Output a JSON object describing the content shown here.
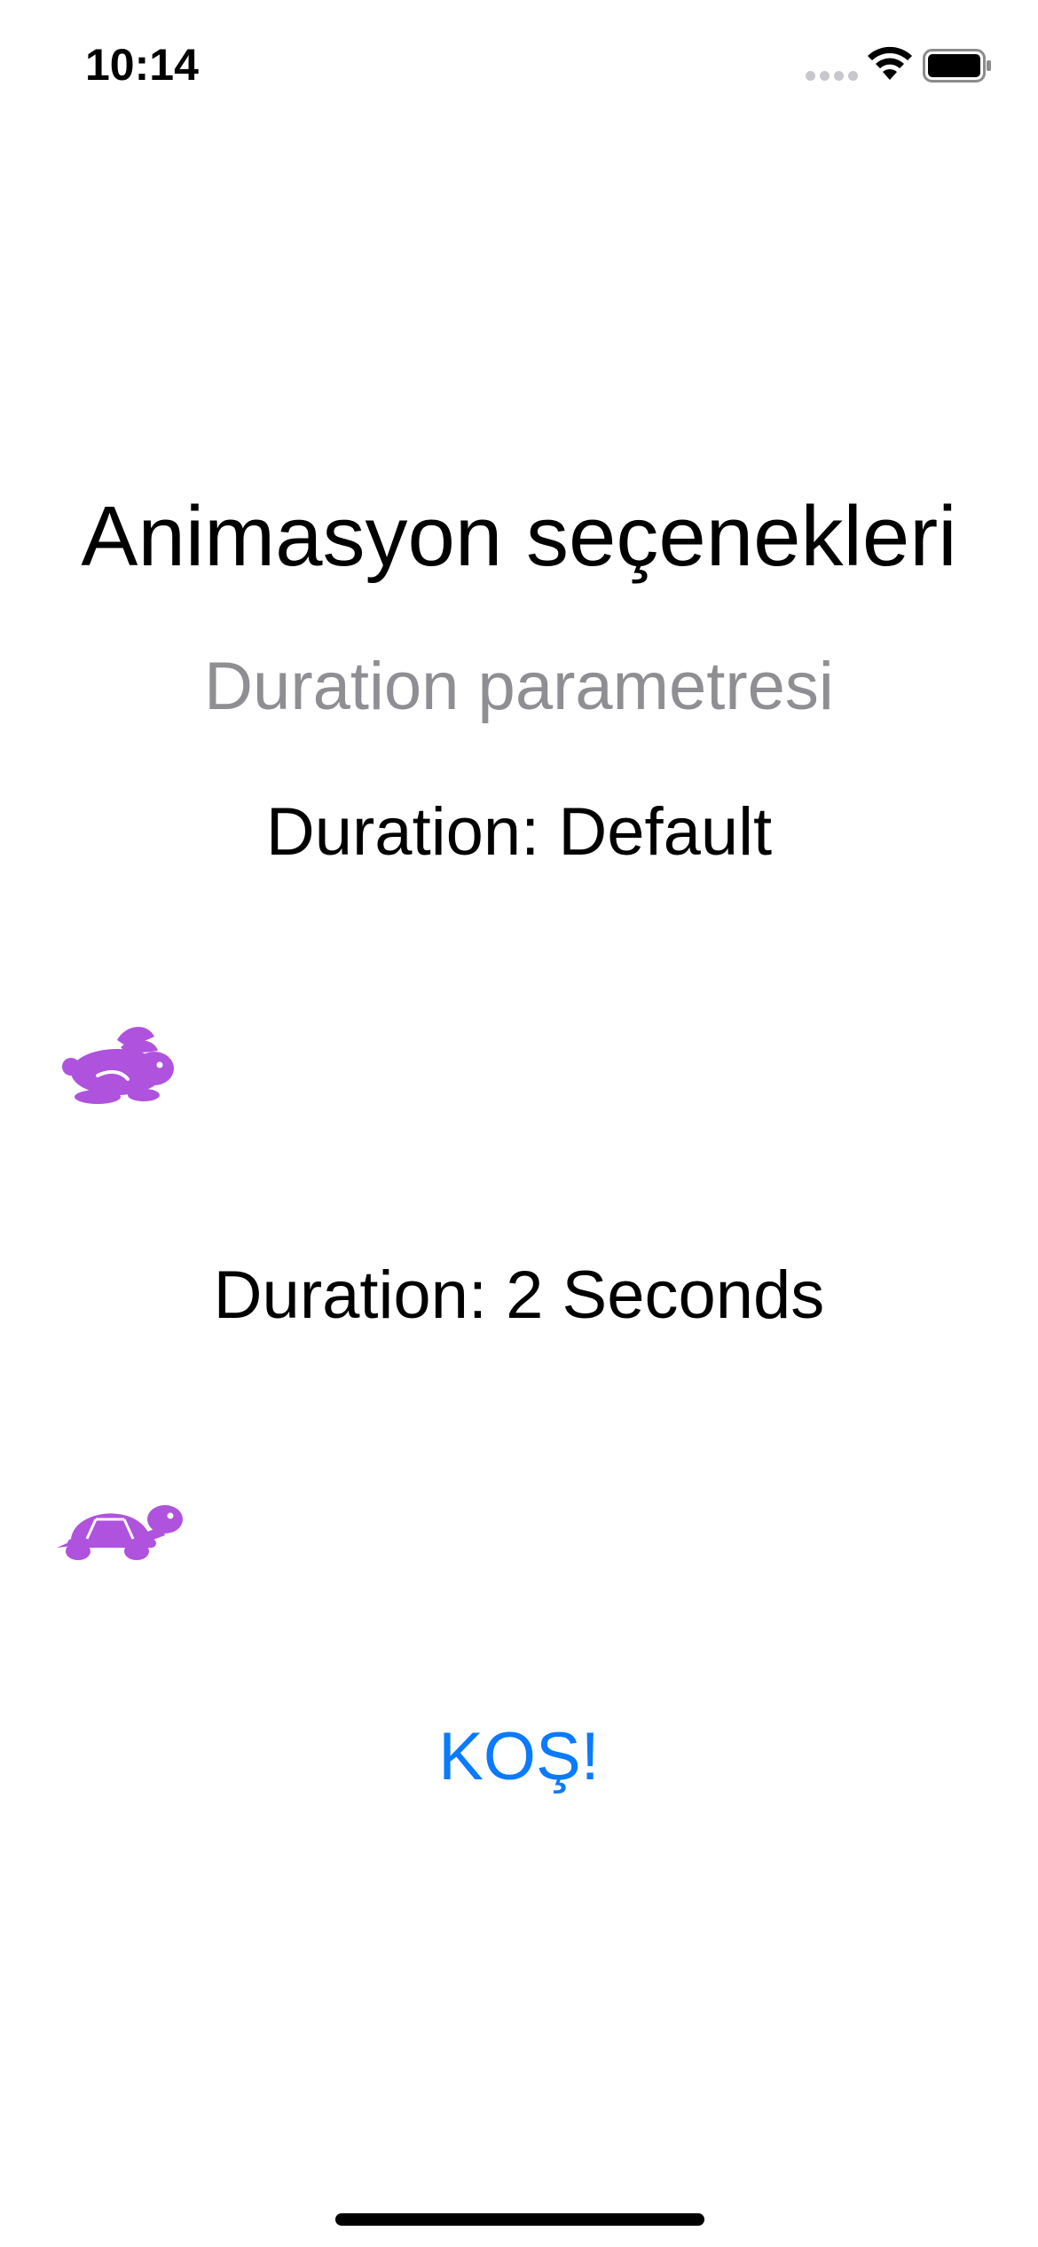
{
  "status_bar": {
    "time": "10:14",
    "signal_icon": "cellular-dots-icon",
    "wifi_icon": "wifi-icon",
    "battery_icon": "battery-icon"
  },
  "main": {
    "title": "Animasyon seçenekleri",
    "subtitle": "Duration parametresi",
    "rows": [
      {
        "label": "Duration: Default",
        "icon": "rabbit-icon",
        "icon_color": "#af52de"
      },
      {
        "label": "Duration: 2 Seconds",
        "icon": "turtle-icon",
        "icon_color": "#af52de"
      }
    ],
    "run_button_label": "KOŞ!"
  },
  "colors": {
    "accent": "#0a7aff",
    "icon_purple": "#af52de",
    "secondary_text": "#8e8e93"
  }
}
